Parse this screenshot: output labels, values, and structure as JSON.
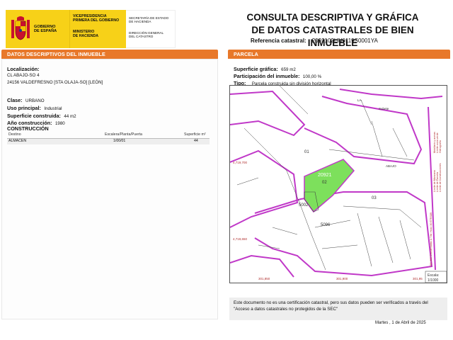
{
  "header": {
    "gov_line1": "GOBIERNO",
    "gov_line2": "DE ESPAÑA",
    "vp_line1": "VICEPRESIDENCIA",
    "vp_line2": "PRIMERA DEL GOBIERNO",
    "min_line1": "MINISTERIO",
    "min_line2": "DE HACIENDA",
    "sec_line1": "SECRETARÍA DE ESTADO",
    "sec_line2": "DE HACIENDA",
    "dir_line1": "DIRECCIÓN GENERAL",
    "dir_line2": "DEL CATASTRO"
  },
  "title": {
    "line1": "CONSULTA DESCRIPTIVA Y GRÁFICA",
    "line2": "DE DATOS CATASTRALES DE BIEN INMUEBLE",
    "ref_label": "Referencia catastral:",
    "ref_value": "2092102UN0119S0001YA"
  },
  "left": {
    "section_title": "DATOS DESCRIPTIVOS DEL INMUEBLE",
    "localizacion_label": "Localización:",
    "address_line1": "CL ABAJO-SO 4",
    "address_line2": "24156 VALDEFRESNO [STA OLAJA-SO] [LEÓN]",
    "clase_label": "Clase:",
    "clase_value": "URBANO",
    "uso_label": "Uso principal:",
    "uso_value": "Industrial",
    "sup_label": "Superficie construida:",
    "sup_value": "44 m2",
    "anio_label": "Año construcción:",
    "anio_value": "1980",
    "construccion_title": "CONSTRUCCIÓN",
    "table": {
      "headers": [
        "Destino",
        "Escalera/Planta/Puerta",
        "Superficie m²"
      ],
      "rows": [
        [
          "ALMACEN",
          "1/00/01",
          "44"
        ]
      ]
    }
  },
  "right": {
    "section_title": "PARCELA",
    "sup_label": "Superficie gráfica:",
    "sup_value": "659 m2",
    "part_label": "Participación del inmueble:",
    "part_value": "100,00 %",
    "tipo_label": "Tipo:",
    "tipo_value": "Parcela construida sin división horizontal"
  },
  "map": {
    "parcel_labels": [
      "01",
      "02",
      "03",
      "5002",
      "5096",
      "20921"
    ],
    "street_labels": [
      "ABAJO",
      "Subete",
      "LA"
    ],
    "coord_labels_left": [
      "4,719,700",
      "4,719,650"
    ],
    "coord_labels_bottom": [
      "301,850",
      "301,900",
      "301,95"
    ],
    "side_legend": [
      "Límite de Manzana",
      "Límite de Parcela",
      "Límite de Construcciones",
      "Mobiliario y aceras",
      "Límite zona verde",
      "Hidrografía"
    ],
    "side_coords": "301,900 Coordenadas U.T.M. Huso 30 ETRS89",
    "scale_label": "Escala:",
    "scale_value": "1/1000"
  },
  "footer": {
    "disclaimer": "Este documento no es una certificación catastral, pero sus datos pueden ser verificados a través del \"Acceso a datos catastrales no protegidos de la SEC\"",
    "date": "Martes , 1 de Abril de 2025"
  },
  "colors": {
    "accent": "#e8782a",
    "header_yellow": "#f7d118",
    "parcel_green": "#7de05c",
    "boundary_magenta": "#c038c8"
  }
}
